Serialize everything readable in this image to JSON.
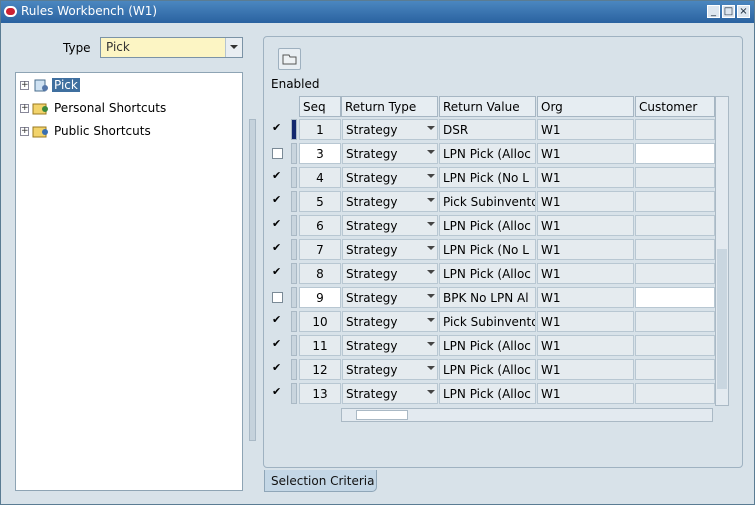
{
  "window": {
    "title": "Rules Workbench (W1)"
  },
  "type_field": {
    "label": "Type",
    "value": "Pick"
  },
  "tree": {
    "items": [
      {
        "label": "Pick",
        "selected": true
      },
      {
        "label": "Personal Shortcuts",
        "selected": false
      },
      {
        "label": "Public Shortcuts",
        "selected": false
      }
    ]
  },
  "grid": {
    "enabled_label": "Enabled",
    "headers": {
      "seq": "Seq",
      "return_type": "Return Type",
      "return_value": "Return Value",
      "org": "Org",
      "customer": "Customer"
    },
    "rows": [
      {
        "enabled": true,
        "seq": "1",
        "return_type": "Strategy",
        "return_value": "DSR",
        "org": "W1"
      },
      {
        "enabled": false,
        "seq": "3",
        "return_type": "Strategy",
        "return_value": "LPN Pick (Alloc",
        "org": "W1"
      },
      {
        "enabled": true,
        "seq": "4",
        "return_type": "Strategy",
        "return_value": "LPN Pick (No L",
        "org": "W1"
      },
      {
        "enabled": true,
        "seq": "5",
        "return_type": "Strategy",
        "return_value": "Pick Subinvento",
        "org": "W1"
      },
      {
        "enabled": true,
        "seq": "6",
        "return_type": "Strategy",
        "return_value": "LPN Pick (Alloc",
        "org": "W1"
      },
      {
        "enabled": true,
        "seq": "7",
        "return_type": "Strategy",
        "return_value": "LPN Pick (No L",
        "org": "W1"
      },
      {
        "enabled": true,
        "seq": "8",
        "return_type": "Strategy",
        "return_value": "LPN Pick (Alloc",
        "org": "W1"
      },
      {
        "enabled": false,
        "seq": "9",
        "return_type": "Strategy",
        "return_value": "BPK No LPN Al",
        "org": "W1"
      },
      {
        "enabled": true,
        "seq": "10",
        "return_type": "Strategy",
        "return_value": "Pick Subinvento",
        "org": "W1"
      },
      {
        "enabled": true,
        "seq": "11",
        "return_type": "Strategy",
        "return_value": "LPN Pick (Alloc",
        "org": "W1"
      },
      {
        "enabled": true,
        "seq": "12",
        "return_type": "Strategy",
        "return_value": "LPN Pick (Alloc",
        "org": "W1"
      },
      {
        "enabled": true,
        "seq": "13",
        "return_type": "Strategy",
        "return_value": "LPN Pick (Alloc",
        "org": "W1"
      }
    ]
  },
  "tabs": {
    "selection_criteria": "Selection Criteria"
  }
}
